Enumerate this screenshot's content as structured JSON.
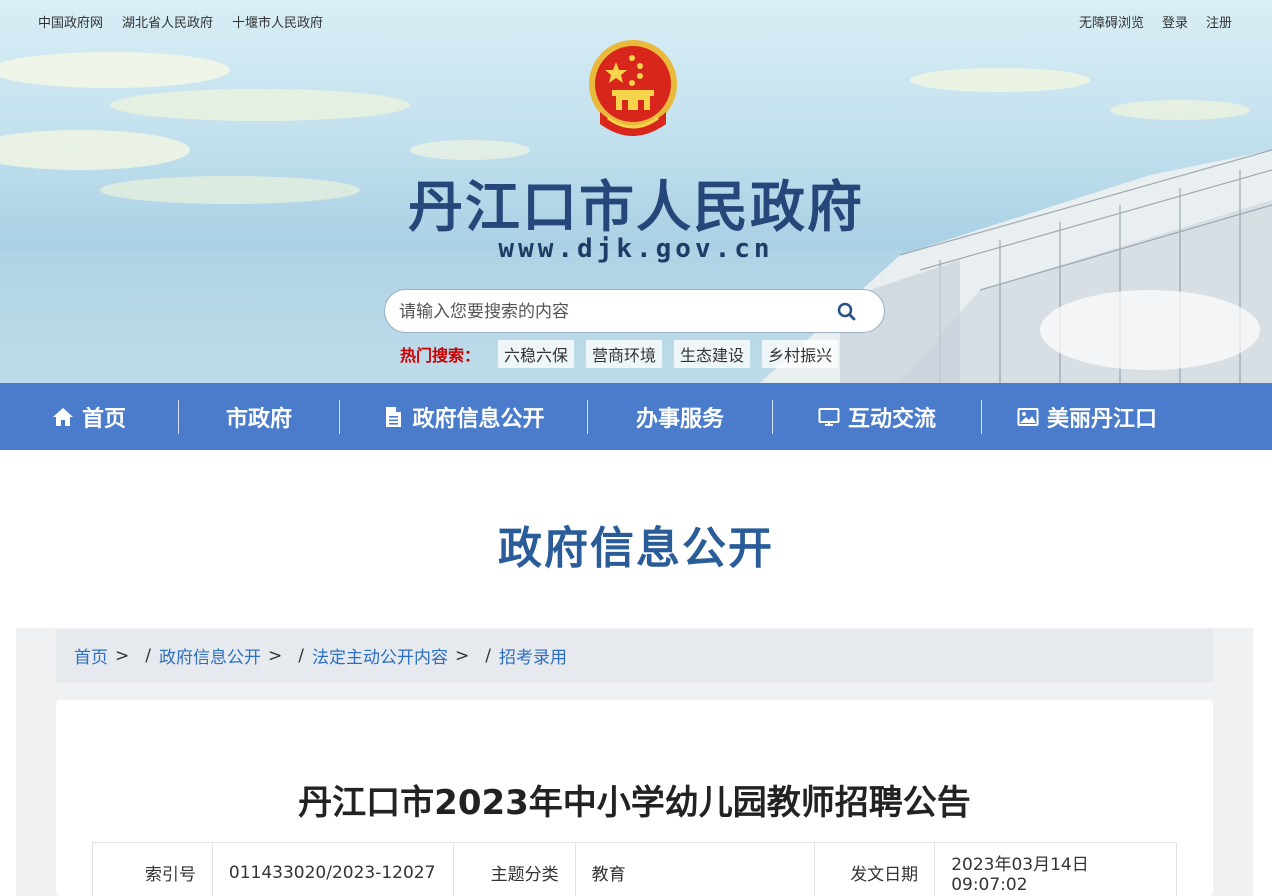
{
  "top_links_left": [
    "中国政府网",
    "湖北省人民政府",
    "十堰市人民政府"
  ],
  "top_links_right": [
    "无障碍浏览",
    "登录",
    "注册"
  ],
  "site": {
    "title": "丹江口市人民政府",
    "url": "www.djk.gov.cn"
  },
  "search": {
    "placeholder": "请输入您要搜索的内容",
    "value": ""
  },
  "hot_search": {
    "label": "热门搜索：",
    "tags": [
      "六稳六保",
      "营商环境",
      "生态建设",
      "乡村振兴"
    ]
  },
  "nav": [
    {
      "label": "首页",
      "icon": "home-icon"
    },
    {
      "label": "市政府",
      "icon": ""
    },
    {
      "label": "政府信息公开",
      "icon": "document-icon"
    },
    {
      "label": "办事服务",
      "icon": ""
    },
    {
      "label": "互动交流",
      "icon": "monitor-icon"
    },
    {
      "label": "美丽丹江口",
      "icon": "picture-icon"
    }
  ],
  "section_title": "政府信息公开",
  "breadcrumb": [
    "首页",
    "政府信息公开",
    "法定主动公开内容",
    "招考录用"
  ],
  "document": {
    "title": "丹江口市2023年中小学幼儿园教师招聘公告",
    "meta": {
      "index_label": "索引号",
      "index_value": "011433020/2023-12027",
      "topic_label": "主题分类",
      "topic_value": "教育",
      "date_label": "发文日期",
      "date_value": "2023年03月14日 09:07:02"
    }
  },
  "colors": {
    "nav_bg": "#4a7ccb",
    "title_blue": "#2a5c99",
    "link_blue": "#2c6fc2",
    "hot_red": "#cc0000"
  }
}
